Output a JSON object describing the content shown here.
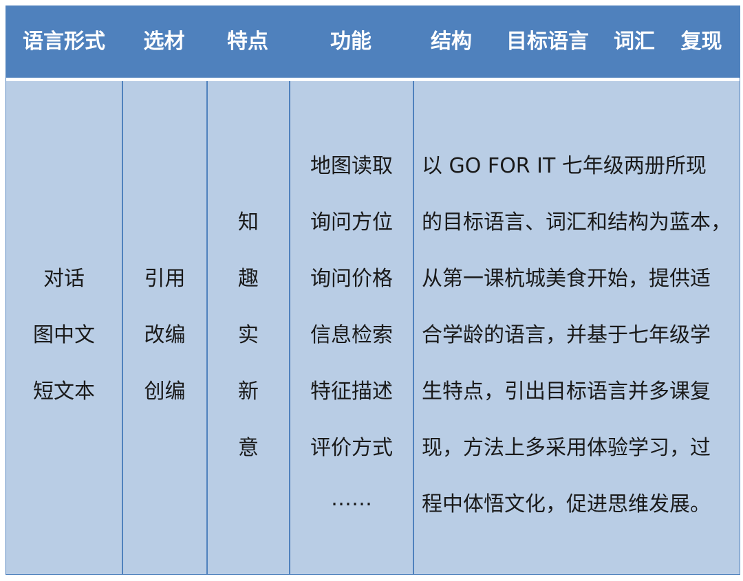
{
  "header": {
    "language_form": "语言形式",
    "material": "选材",
    "features": "特点",
    "functions": "功能",
    "structure": "结构",
    "target_language": "目标语言",
    "vocabulary": "词汇",
    "recurrence": "复现"
  },
  "row": {
    "language_form": [
      "对话",
      "图中文",
      "短文本"
    ],
    "material": [
      "引用",
      "改编",
      "创编"
    ],
    "features": [
      "知",
      "趣",
      "实",
      "新",
      "意"
    ],
    "functions": [
      "地图读取",
      "询问方位",
      "询问价格",
      "信息检索",
      "特征描述",
      "评价方式",
      "……"
    ],
    "description_lines": [
      "以 GO FOR IT  七年级两册所现",
      "的目标语言、词汇和结构为蓝本，",
      "从第一课杭城美食开始，提供适",
      "合学龄的语言，并基于七年级学",
      "生特点，引出目标语言并多课复",
      "现，方法上多采用体验学习，过",
      "程中体悟文化，促进思维发展。"
    ]
  },
  "colors": {
    "header_bg": "#4f81bd",
    "body_bg": "#b9cde5",
    "header_text": "#ffffff",
    "body_text": "#1a1a1a"
  }
}
